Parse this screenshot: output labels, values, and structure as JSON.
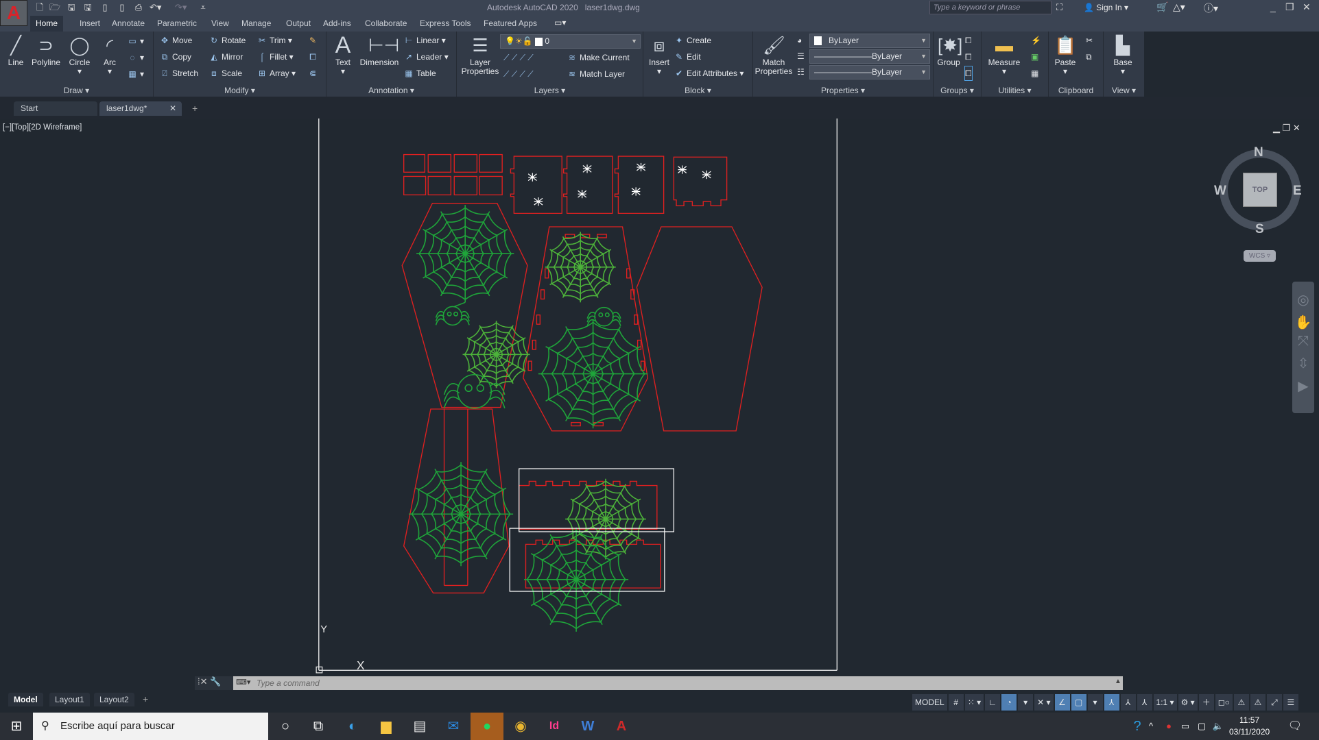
{
  "app": {
    "logo": "A",
    "title": "Autodesk AutoCAD 2020",
    "filename": "laser1dwg.dwg",
    "search_placeholder": "Type a keyword or phrase",
    "sign_in": "Sign In"
  },
  "quick_access": [
    "new-icon",
    "open-icon",
    "save-icon",
    "save-as-icon",
    "open-web-icon",
    "save-web-icon",
    "plot-icon",
    "undo-icon",
    "redo-icon"
  ],
  "ribbon_tabs": [
    "Home",
    "Insert",
    "Annotate",
    "Parametric",
    "View",
    "Manage",
    "Output",
    "Add-ins",
    "Collaborate",
    "Express Tools",
    "Featured Apps"
  ],
  "active_ribbon_tab": "Home",
  "panels": {
    "draw": {
      "label": "Draw",
      "line": "Line",
      "polyline": "Polyline",
      "circle": "Circle",
      "arc": "Arc"
    },
    "modify": {
      "label": "Modify",
      "move": "Move",
      "rotate": "Rotate",
      "trim": "Trim",
      "copy": "Copy",
      "mirror": "Mirror",
      "fillet": "Fillet",
      "stretch": "Stretch",
      "scale": "Scale",
      "array": "Array"
    },
    "annotation": {
      "label": "Annotation",
      "text": "Text",
      "dimension": "Dimension",
      "linear": "Linear",
      "leader": "Leader",
      "table": "Table"
    },
    "layers": {
      "label": "Layers",
      "layer_properties": "Layer Properties",
      "current_layer": "0",
      "make_current": "Make Current",
      "match_layer": "Match Layer"
    },
    "block": {
      "label": "Block",
      "insert": "Insert",
      "create": "Create",
      "edit": "Edit",
      "edit_attributes": "Edit Attributes"
    },
    "properties": {
      "label": "Properties",
      "match_properties": "Match Properties",
      "color": "ByLayer",
      "linetype": "ByLayer",
      "lineweight": "ByLayer"
    },
    "groups": {
      "label": "Groups",
      "group": "Group"
    },
    "utilities": {
      "label": "Utilities",
      "measure": "Measure"
    },
    "clipboard": {
      "label": "Clipboard",
      "paste": "Paste"
    },
    "view": {
      "label": "View",
      "base": "Base"
    }
  },
  "doc_tabs": [
    {
      "label": "Start"
    },
    {
      "label": "laser1dwg*",
      "active": true
    }
  ],
  "viewport": {
    "label": "[−][Top][2D Wireframe]",
    "viewcube": {
      "top": "TOP",
      "n": "N",
      "s": "S",
      "e": "E",
      "w": "W",
      "ucs": "WCS"
    },
    "ucs_x": "X",
    "ucs_y": "Y"
  },
  "command": {
    "placeholder": "Type a command"
  },
  "layout_tabs": [
    "Model",
    "Layout1",
    "Layout2"
  ],
  "status": {
    "model": "MODEL",
    "scale": "1:1"
  },
  "taskbar": {
    "search": "Escribe aquí para buscar",
    "time": "11:57",
    "date": "03/11/2020",
    "apps": [
      "cortana-icon",
      "task-view-icon",
      "edge-icon",
      "file-explorer-icon",
      "store-icon",
      "mail-icon",
      "spotify-icon",
      "chrome-icon",
      "indesign-icon",
      "word-icon",
      "autocad-icon"
    ]
  },
  "colors": {
    "cut_lines": "#e02020",
    "engrave": "#1fa53a",
    "engrave_light": "#4db33a",
    "canvas": "#212830",
    "ribbon": "#323a47",
    "accent": "#4f7fb3"
  }
}
